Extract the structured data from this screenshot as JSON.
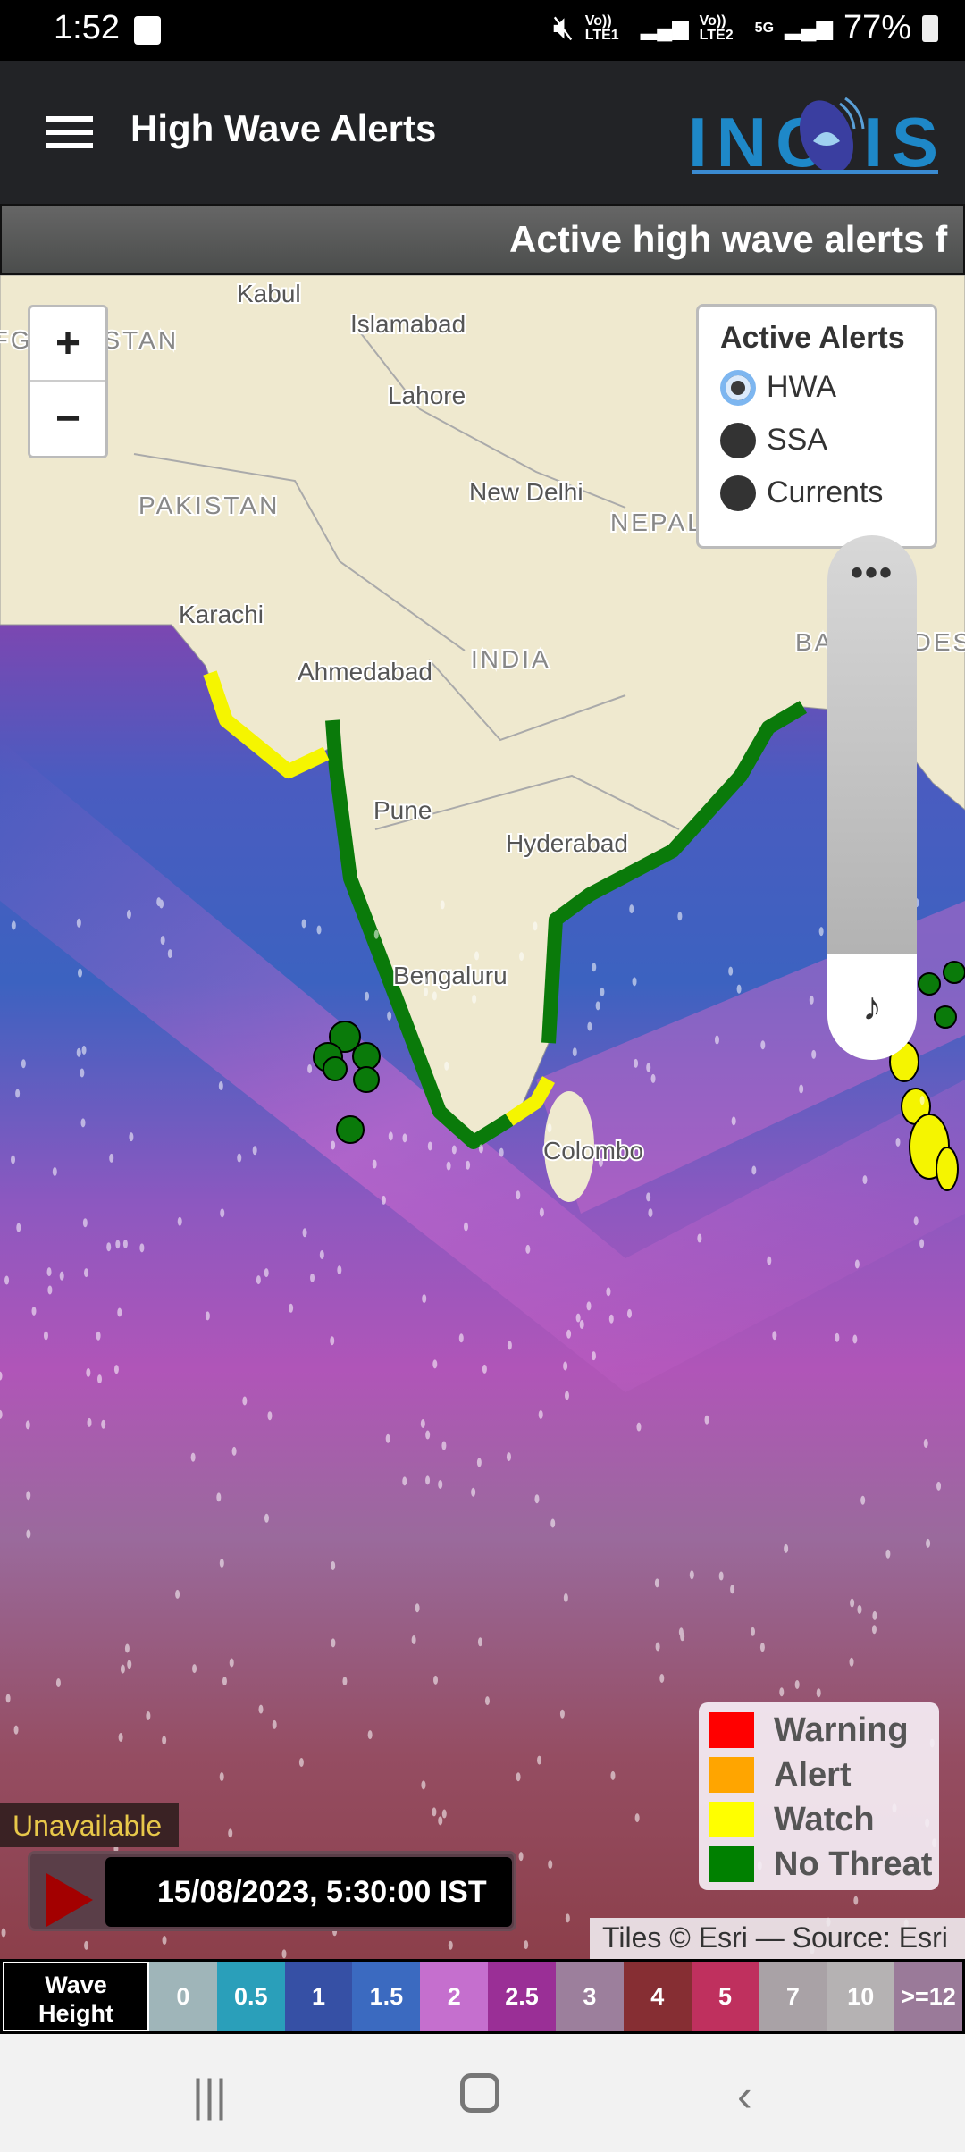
{
  "status_bar": {
    "time": "1:52",
    "sim1": "Vo)) LTE1",
    "sim2": "Vo)) LTE2",
    "network": "5G",
    "battery": "77%"
  },
  "header": {
    "title": "High Wave Alerts",
    "logo": "INCOIS",
    "menu_icon": "hamburger-icon"
  },
  "ticker": {
    "text": "Active high wave alerts f"
  },
  "map": {
    "labels": {
      "kabul": "Kabul",
      "islamabad": "Islamabad",
      "lahore": "Lahore",
      "afghanistan": "AFGHANISTAN",
      "pakistan": "PAKISTAN",
      "new_delhi": "New Delhi",
      "nepal": "NEPAL",
      "karachi": "Karachi",
      "ahmedabad": "Ahmedabad",
      "india": "INDIA",
      "bangladesh": "BANGLADESH",
      "pune": "Pune",
      "hyderabad": "Hyderabad",
      "bengaluru": "Bengaluru",
      "colombo": "Colombo"
    },
    "zoom_in": "+",
    "zoom_out": "−",
    "active_alerts": {
      "title": "Active Alerts",
      "options": [
        {
          "label": "HWA",
          "selected": true
        },
        {
          "label": "SSA",
          "selected": false
        },
        {
          "label": "Currents",
          "selected": false
        }
      ]
    },
    "slider": {
      "menu": "•••",
      "icon": "music-note-icon"
    },
    "legend": [
      {
        "label": "Warning",
        "color": "#ff0000"
      },
      {
        "label": "Alert",
        "color": "#ffa500"
      },
      {
        "label": "Watch",
        "color": "#ffff00"
      },
      {
        "label": "No Threat",
        "color": "#008000"
      }
    ],
    "status": "Unavailable",
    "datetime": "15/08/2023, 5:30:00 IST",
    "attribution": "Tiles © Esri — Source: Esri"
  },
  "wave_height": {
    "label_line1": "Wave",
    "label_line2": "Height",
    "scale": [
      {
        "v": "0",
        "color": "#9fb5b9"
      },
      {
        "v": "0.5",
        "color": "#2a9fba"
      },
      {
        "v": "1",
        "color": "#3650a5"
      },
      {
        "v": "1.5",
        "color": "#3b6ac0"
      },
      {
        "v": "2",
        "color": "#c56fce"
      },
      {
        "v": "2.5",
        "color": "#9a2f96"
      },
      {
        "v": "3",
        "color": "#9c7f9c"
      },
      {
        "v": "4",
        "color": "#862e33"
      },
      {
        "v": "5",
        "color": "#bf305e"
      },
      {
        "v": "7",
        "color": "#a9a2a6"
      },
      {
        "v": "10",
        "color": "#b5b2b3"
      },
      {
        "v": ">=12",
        "color": "#9a7a99"
      }
    ]
  }
}
